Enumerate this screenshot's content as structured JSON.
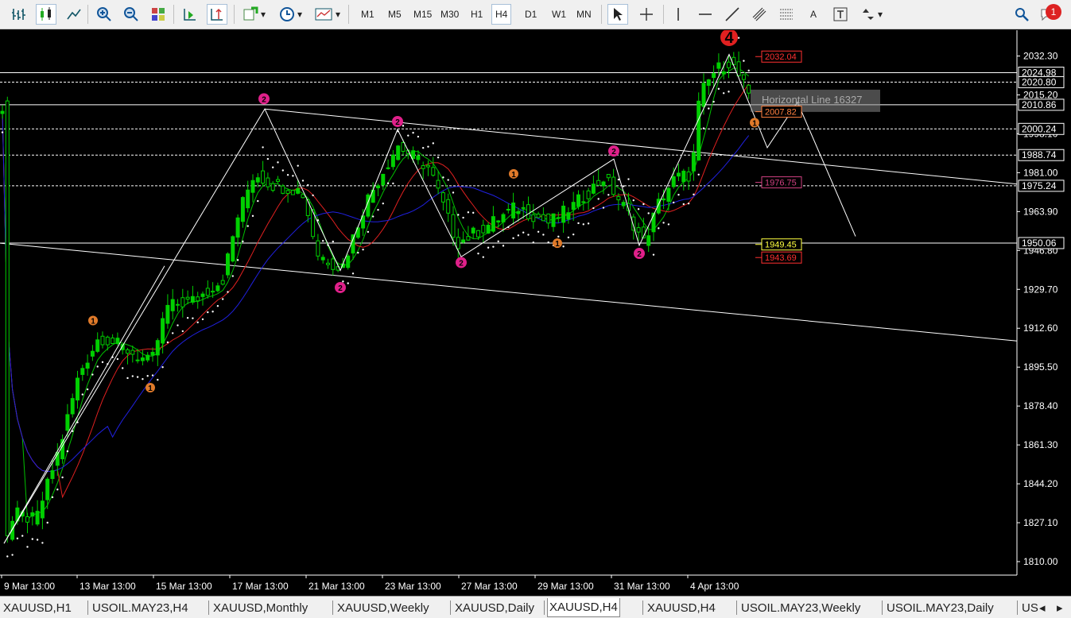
{
  "toolbar": {
    "timeframes": [
      "M1",
      "M5",
      "M15",
      "M30",
      "H1",
      "H4",
      "D1",
      "W1",
      "MN"
    ],
    "active_timeframe": "H4",
    "font_tool_label": "A",
    "notification_count": "1"
  },
  "chart_data": {
    "type": "candlestick",
    "symbol": "XAUUSD",
    "timeframe": "H4",
    "ylim": [
      1802,
      2045
    ],
    "y_ticks": [
      "2032.30",
      "2015.20",
      "1998.10",
      "1981.00",
      "1963.90",
      "1946.80",
      "1929.70",
      "1912.60",
      "1895.50",
      "1878.40",
      "1861.30",
      "1844.20",
      "1827.10",
      "1810.00"
    ],
    "x_ticks": [
      "9 Mar 13:00",
      "13 Mar 13:00",
      "15 Mar 13:00",
      "17 Mar 13:00",
      "21 Mar 13:00",
      "23 Mar 13:00",
      "27 Mar 13:00",
      "29 Mar 13:00",
      "31 Mar 13:00",
      "4 Apr 13:00"
    ],
    "price_labels": [
      {
        "text": "2024.98",
        "value": 2024.98,
        "color": "#ffffff"
      },
      {
        "text": "2020.80",
        "value": 2020.8,
        "color": "#ffffff"
      },
      {
        "text": "2010.86",
        "value": 2010.86,
        "color": "#ffffff"
      },
      {
        "text": "2000.24",
        "value": 2000.24,
        "color": "#ffffff"
      },
      {
        "text": "1988.74",
        "value": 1988.74,
        "color": "#ffffff"
      },
      {
        "text": "1975.24",
        "value": 1975.24,
        "color": "#ffffff"
      },
      {
        "text": "1950.06",
        "value": 1950.06,
        "color": "#ffffff"
      }
    ],
    "horizontal_lines": [
      2024.98,
      2020.8,
      2010.86,
      2000.24,
      1988.74,
      1975.24,
      1950.06
    ],
    "order_labels": [
      {
        "text": "2032.04",
        "value": 2032.04,
        "color": "#ff3030"
      },
      {
        "text": "2007.82",
        "value": 2007.82,
        "color": "#ff8040"
      },
      {
        "text": "1976.75",
        "value": 1976.75,
        "color": "#d04080"
      },
      {
        "text": "1949.45",
        "value": 1949.45,
        "color": "#ffff40"
      },
      {
        "text": "1943.69",
        "value": 1943.69,
        "color": "#ff3030"
      }
    ],
    "object_label": "Horizontal Line 16327",
    "wave_labels": [
      {
        "text": "4",
        "style": "big",
        "x": 917,
        "y": 2040.5
      },
      {
        "text": "2",
        "style": "mag",
        "x": 332,
        "y": 2013.5
      },
      {
        "text": "2",
        "style": "mag",
        "x": 500,
        "y": 2003.5
      },
      {
        "text": "2",
        "style": "mag",
        "x": 772,
        "y": 1990.5
      },
      {
        "text": "2",
        "style": "mag",
        "x": 428,
        "y": 1930.5
      },
      {
        "text": "2",
        "style": "mag",
        "x": 580,
        "y": 1941.5
      },
      {
        "text": "2",
        "style": "mag",
        "x": 804,
        "y": 1945.5
      },
      {
        "text": "1",
        "style": "org",
        "x": 117,
        "y": 1916
      },
      {
        "text": "1",
        "style": "org",
        "x": 189,
        "y": 1886.5
      },
      {
        "text": "1",
        "style": "org",
        "x": 646,
        "y": 1980.5
      },
      {
        "text": "1",
        "style": "org",
        "x": 701,
        "y": 1950
      },
      {
        "text": "1",
        "style": "org",
        "x": 949,
        "y": 2003
      }
    ],
    "colors": {
      "bull": "#00d000",
      "bear": "#00d000",
      "grid": "#ffffff",
      "ma_fast": "#00c000",
      "ma_mid": "#e02020",
      "ma_slow": "#2020e0",
      "psar": "#ffffff"
    }
  },
  "tabs": [
    {
      "label": "XAUUSD,H1",
      "active": false
    },
    {
      "label": "USOIL.MAY23,H4",
      "active": false
    },
    {
      "label": "XAUUSD,Monthly",
      "active": false
    },
    {
      "label": "XAUUSD,Weekly",
      "active": false
    },
    {
      "label": "XAUUSD,Daily",
      "active": false
    },
    {
      "label": "XAUUSD,H4",
      "active": true
    },
    {
      "label": "XAUUSD,H4",
      "active": false
    },
    {
      "label": "USOIL.MAY23,Weekly",
      "active": false
    },
    {
      "label": "USOIL.MAY23,Daily",
      "active": false
    },
    {
      "label": "US",
      "active": false
    }
  ]
}
